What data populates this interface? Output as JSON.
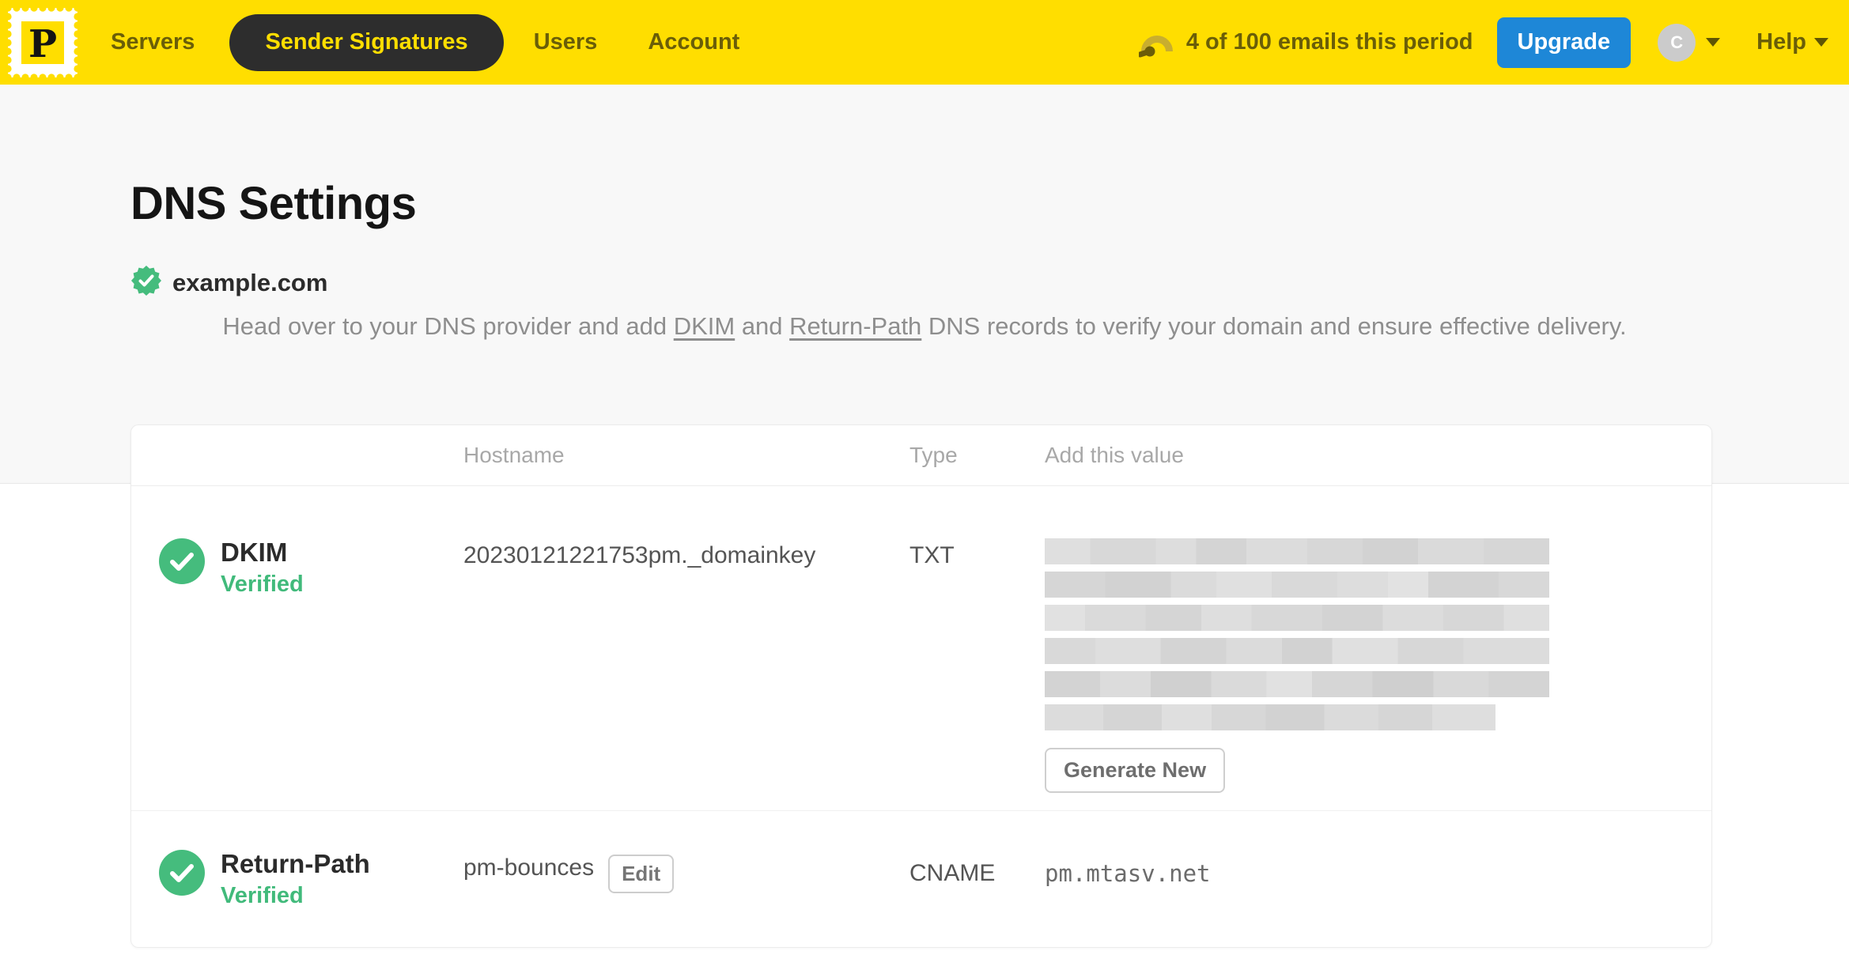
{
  "nav": {
    "logo_letter": "P",
    "items": [
      {
        "label": "Servers",
        "active": false
      },
      {
        "label": "Sender Signatures",
        "active": true
      },
      {
        "label": "Users",
        "active": false
      },
      {
        "label": "Account",
        "active": false
      }
    ],
    "usage_text": "4 of 100 emails this period",
    "upgrade_label": "Upgrade",
    "avatar_initial": "C",
    "help_label": "Help"
  },
  "page": {
    "title": "DNS Settings",
    "domain": "example.com",
    "intro": {
      "part1": "Head over to your DNS provider and add ",
      "dkim_link": "DKIM",
      "part2": " and ",
      "return_path_link": "Return-Path",
      "part3": " DNS records to verify your domain and ensure effective delivery."
    }
  },
  "dns_table": {
    "headers": {
      "hostname": "Hostname",
      "type": "Type",
      "value": "Add this value"
    },
    "dkim_row": {
      "name": "DKIM",
      "status": "Verified",
      "hostname": "20230121221753pm._domainkey",
      "type": "TXT",
      "value_redacted": true,
      "generate_label": "Generate New"
    },
    "return_path_row": {
      "name": "Return-Path",
      "status": "Verified",
      "hostname": "pm-bounces",
      "edit_label": "Edit",
      "type": "CNAME",
      "value": "pm.mtasv.net"
    }
  },
  "colors": {
    "brand_yellow": "#FFDE00",
    "nav_pill_dark": "#2D2D2D",
    "upgrade_blue": "#1E87D7",
    "success_green": "#45BC7D",
    "muted_text": "#8E8E8E"
  }
}
